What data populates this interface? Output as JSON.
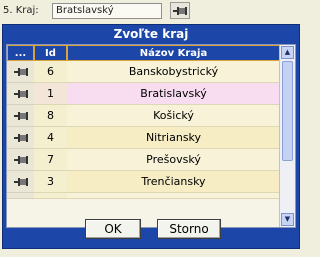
{
  "field": {
    "label": "5. Kraj:",
    "value": "Bratslavský"
  },
  "dialog": {
    "title": "Zvoľte kraj",
    "columns": [
      "...",
      "Id",
      "Názov Kraja"
    ],
    "rows": [
      {
        "id": "6",
        "name": "Banskobystrický"
      },
      {
        "id": "1",
        "name": "Bratislavský"
      },
      {
        "id": "8",
        "name": "Košický"
      },
      {
        "id": "4",
        "name": "Nitriansky"
      },
      {
        "id": "7",
        "name": "Prešovský"
      },
      {
        "id": "3",
        "name": "Trenčiansky"
      }
    ],
    "selected_row_index": 1,
    "ok_label": "OK",
    "cancel_label": "Storno"
  },
  "colors": {
    "dialog_blue": "#1c47a8",
    "header_border": "#d9a33a",
    "selected_row": "#f8dcef"
  },
  "icons": {
    "row_action": "pin-icon",
    "field_lookup": "pin-icon"
  }
}
